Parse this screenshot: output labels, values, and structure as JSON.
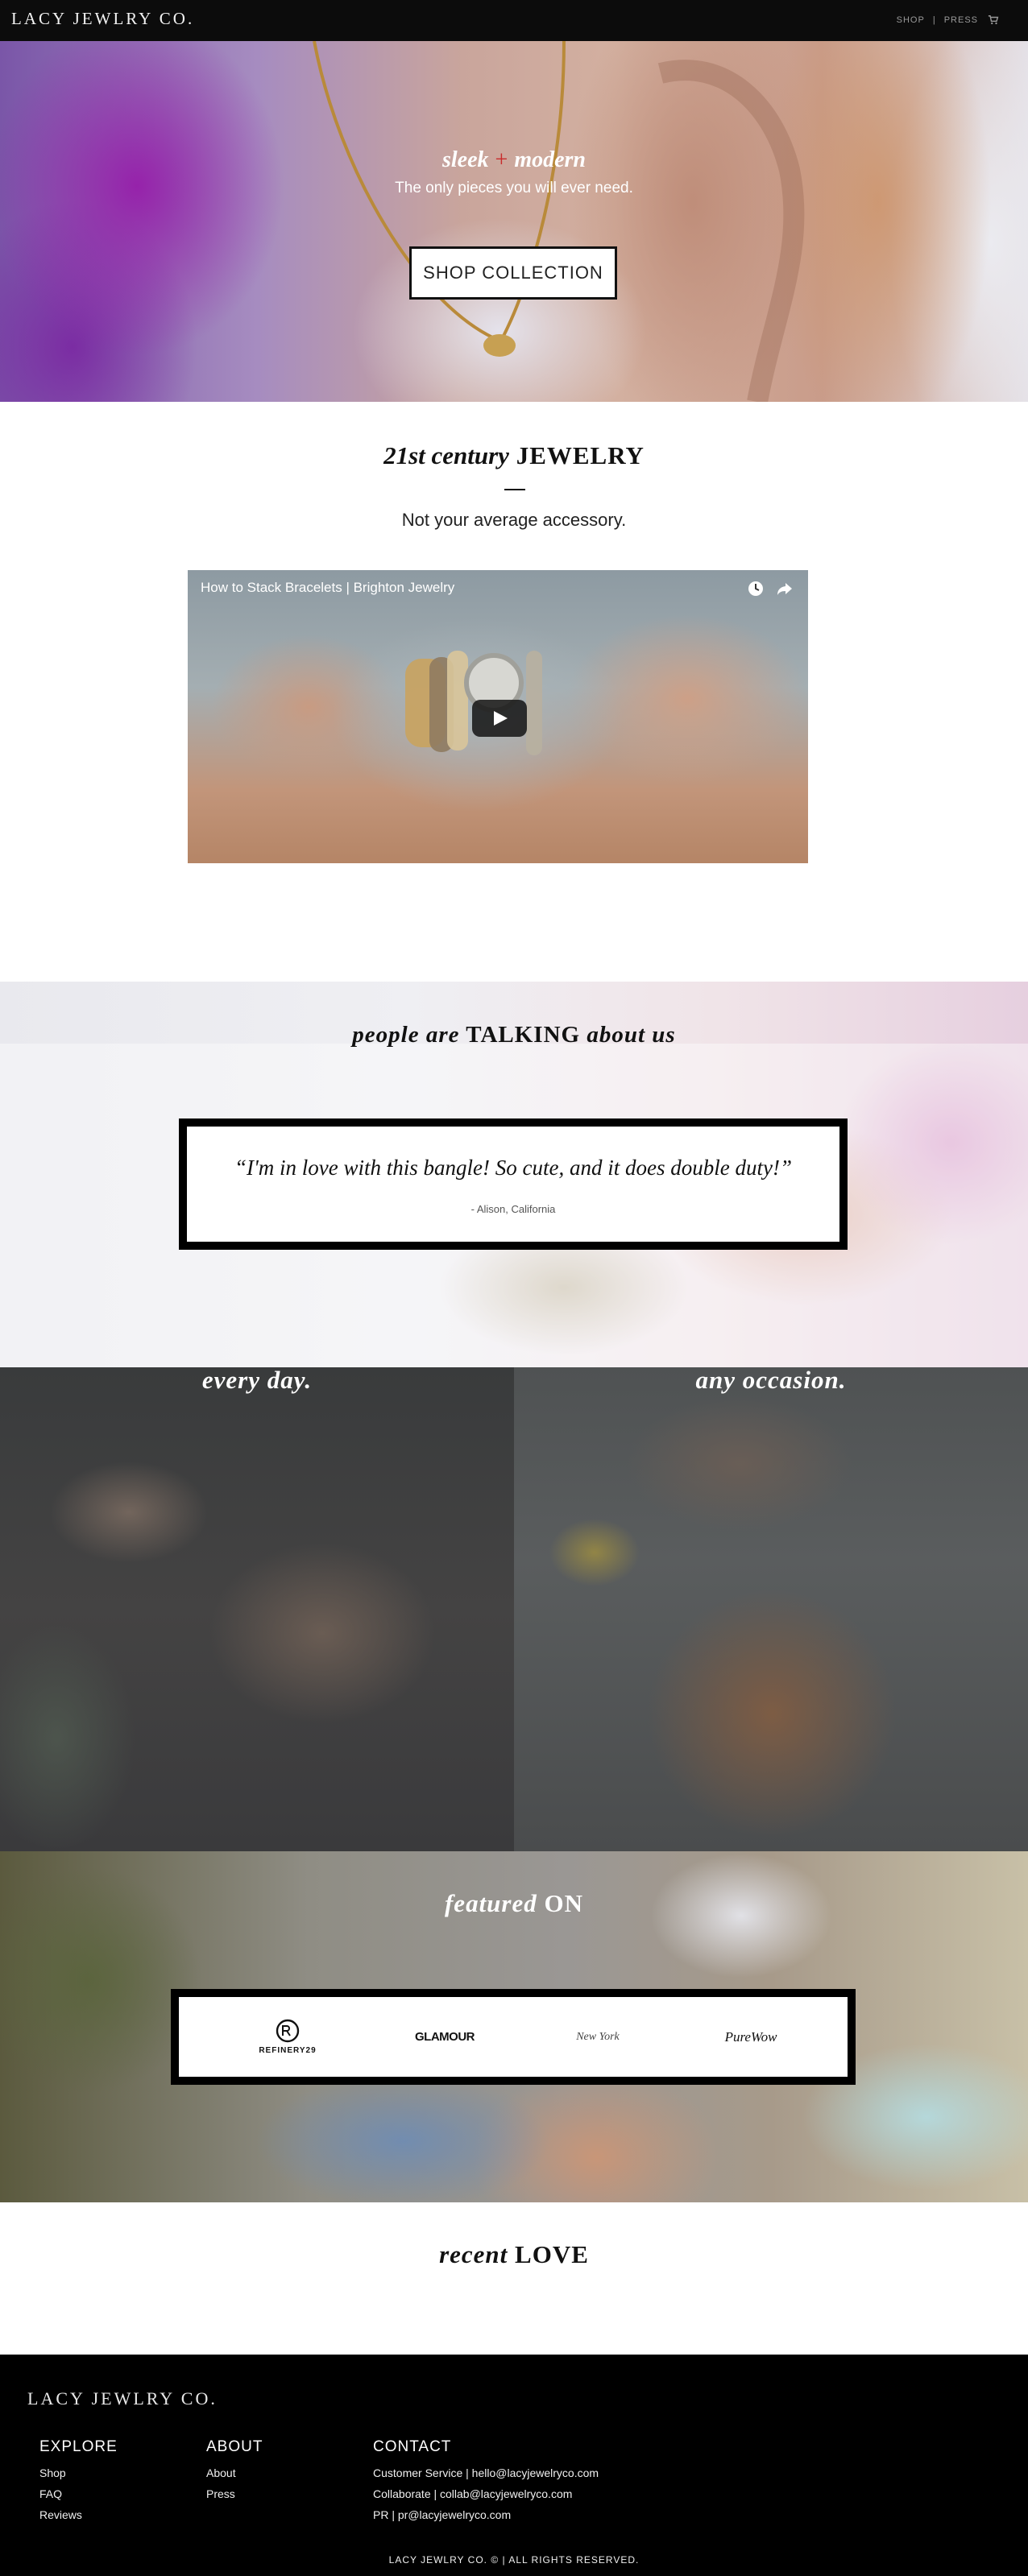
{
  "header": {
    "brand": "LACY JEWLRY CO.",
    "nav": [
      {
        "label": "SHOP"
      },
      {
        "label": "PRESS"
      }
    ],
    "nav_separator": "|",
    "cart_icon": "cart-icon"
  },
  "hero": {
    "tagline_left": "sleek",
    "tagline_plus": "+",
    "tagline_right": "modern",
    "subtitle": "The only pieces you will ever need.",
    "cta_label": "SHOP COLLECTION"
  },
  "intro": {
    "heading_italic": "21st century",
    "heading_caps": "JEWELRY",
    "subtitle": "Not your average accessory."
  },
  "video": {
    "title": "How to Stack Bracelets | Brighton Jewelry",
    "icons": [
      "clock-icon",
      "share-icon",
      "play-icon"
    ]
  },
  "testimonials": {
    "heading_part1": "people are",
    "heading_part2": "TALKING",
    "heading_part3": "about us",
    "quote": "“I'm in love with this bangle! So cute, and it does double duty!”",
    "author": "- Alison, California"
  },
  "split": {
    "left_title": "every day.",
    "right_title": "any occasion."
  },
  "featured": {
    "heading_italic": "featured",
    "heading_caps": "ON",
    "logos": {
      "refinery29": "REFINERY29",
      "glamour": "GLAMOUR",
      "nymag": "New York",
      "purewow": "PureWow"
    }
  },
  "recent": {
    "heading_italic": "recent",
    "heading_caps": "LOVE"
  },
  "footer": {
    "brand": "LACY JEWLRY CO.",
    "explore": {
      "title": "EXPLORE",
      "links": [
        "Shop",
        "FAQ",
        "Reviews"
      ]
    },
    "about": {
      "title": "ABOUT",
      "links": [
        "About",
        "Press"
      ]
    },
    "contact": {
      "title": "CONTACT",
      "links": [
        "Customer Service | hello@lacyjewelryco.com",
        "Collaborate | collab@lacyjewelryco.com",
        "PR | pr@lacyjewelryco.com"
      ]
    },
    "copyright": "LACY JEWLRY CO. © | ALL RIGHTS RESERVED."
  },
  "colors": {
    "header_bg": "#0c0c0c",
    "accent_plus": "#c92b2b",
    "footer_bg": "#000000",
    "box_border": "#000000"
  }
}
